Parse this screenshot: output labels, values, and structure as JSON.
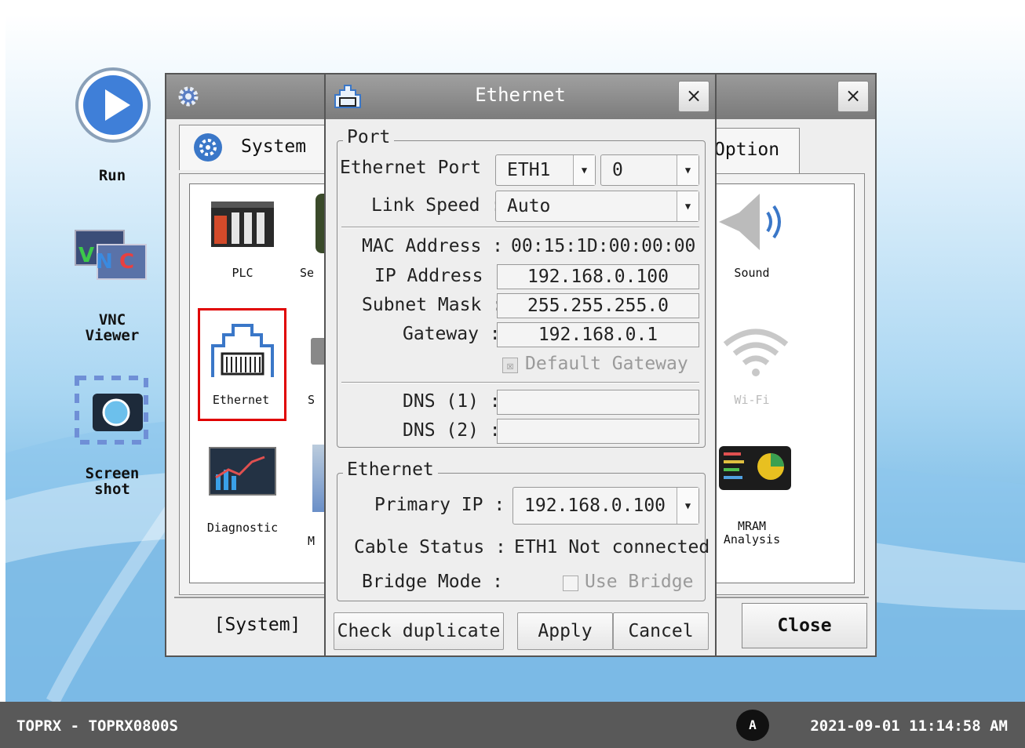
{
  "desktop": {
    "icons": [
      {
        "label": "Run"
      },
      {
        "label": "VNC\nViewer"
      },
      {
        "label": "Screen\nshot"
      }
    ]
  },
  "system_window": {
    "tab_system": "System",
    "tab_option": "Option",
    "tiles": {
      "plc": "PLC",
      "ethernet": "Ethernet",
      "diagnostic": "Diagnostic",
      "sound": "Sound",
      "wifi": "Wi-Fi",
      "mram": "MRAM\nAnalysis",
      "partial_se": "Se",
      "partial_s": "S",
      "partial_m": "M"
    },
    "bottom_label": "[System]",
    "close_label": "Close"
  },
  "ethernet_dialog": {
    "title": "Ethernet",
    "close_glyph": "×",
    "port_group": {
      "title": "Port",
      "ethernet_port_label": "Ethernet Port :",
      "ethernet_port_value": "ETH1",
      "ethernet_port_index": "0",
      "link_speed_label": "Link Speed :",
      "link_speed_value": "Auto",
      "mac_label": "MAC Address :",
      "mac_value": "00:15:1D:00:00:00",
      "ip_label": "IP Address :",
      "ip_value": "192.168.0.100",
      "subnet_label": "Subnet Mask :",
      "subnet_value": "255.255.255.0",
      "gateway_label": "Gateway :",
      "gateway_value": "192.168.0.1",
      "default_gateway_label": "Default Gateway",
      "dns1_label": "DNS (1) :",
      "dns1_value": "",
      "dns2_label": "DNS (2) :",
      "dns2_value": ""
    },
    "ethernet_group": {
      "title": "Ethernet",
      "primary_ip_label": "Primary IP :",
      "primary_ip_value": "192.168.0.100",
      "cable_status_label": "Cable Status :",
      "cable_status_value": "ETH1 Not connected",
      "bridge_mode_label": "Bridge Mode :",
      "use_bridge_label": "Use Bridge"
    },
    "buttons": {
      "check_duplicate": "Check duplicate",
      "apply": "Apply",
      "cancel": "Cancel"
    }
  },
  "taskbar": {
    "left_text": "TOPRX - TOPRX0800S",
    "badge": "A",
    "datetime": "2021-09-01 11:14:58 AM"
  },
  "colors": {
    "highlight_border": "#e00000",
    "taskbar": "#595959",
    "titlebar": "#8a8a8a"
  }
}
